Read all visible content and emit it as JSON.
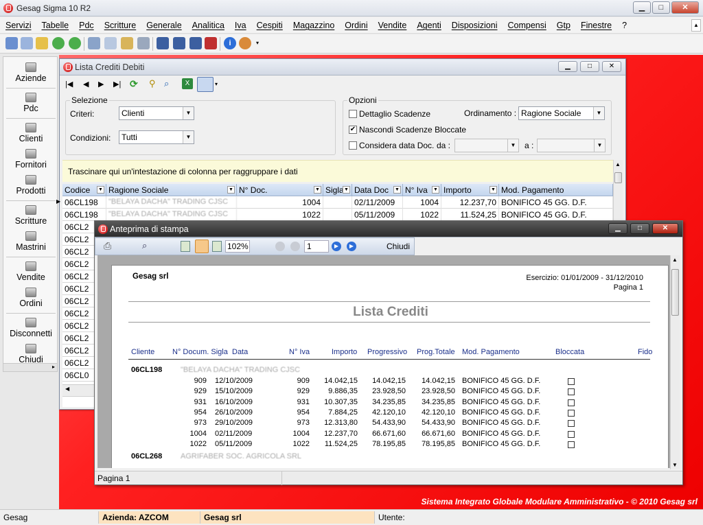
{
  "app": {
    "title": "Gesag Sigma 10 R2"
  },
  "menu": [
    "Servizi",
    "Tabelle",
    "Pdc",
    "Scritture",
    "Generale",
    "Analitica",
    "Iva",
    "Cespiti",
    "Magazzino",
    "Ordini",
    "Vendite",
    "Agenti",
    "Disposizioni",
    "Compensi",
    "Gtp",
    "Finestre",
    "?"
  ],
  "sidebar": [
    {
      "label": "Aziende",
      "icon": "gear-icon"
    },
    {
      "label": "Pdc",
      "icon": "tree-icon"
    },
    {
      "label": "Clienti",
      "icon": "client-icon"
    },
    {
      "label": "Fornitori",
      "icon": "supplier-icon"
    },
    {
      "label": "Prodotti",
      "icon": "products-icon"
    },
    {
      "label": "Scritture",
      "icon": "journal-icon"
    },
    {
      "label": "Mastrini",
      "icon": "ledger-icon"
    },
    {
      "label": "Vendite",
      "icon": "sales-icon"
    },
    {
      "label": "Ordini",
      "icon": "orders-icon"
    },
    {
      "label": "Disconnetti",
      "icon": "disconnect-icon"
    },
    {
      "label": "Chiudi",
      "icon": "exit-icon"
    }
  ],
  "desktop_footer": "Sistema Integrato Globale Modulare Amministrativo - © 2010 Gesag srl",
  "crediti_window": {
    "title": "Lista Crediti Debiti",
    "selezione": {
      "legend": "Selezione",
      "criteri_label": "Criteri:",
      "criteri_value": "Clienti",
      "condizioni_label": "Condizioni:",
      "condizioni_value": "Tutti"
    },
    "opzioni": {
      "legend": "Opzioni",
      "dettaglio": "Dettaglio Scadenze",
      "nascondi": "Nascondi Scadenze Bloccate",
      "considera": "Considera data Doc.",
      "ordinamento_label": "Ordinamento :",
      "ordinamento_value": "Ragione Sociale",
      "da_label": "da :",
      "a_label": "a :"
    },
    "group_hint": "Trascinare qui un'intestazione di colonna per raggruppare i dati",
    "columns": [
      "Codice",
      "Ragione Sociale",
      "N° Doc.",
      "Sigla",
      "Data Doc",
      "N° Iva",
      "Importo",
      "Mod. Pagamento"
    ],
    "rows": [
      {
        "codice": "06CL198",
        "ragione": "\"BELAYA DACHA\" TRADING CJSC",
        "ndoc": "1004",
        "sigla": "",
        "data": "02/11/2009",
        "niva": "1004",
        "importo": "12.237,70",
        "pag": "BONIFICO 45 GG. D.F."
      },
      {
        "codice": "06CL198",
        "ragione": "\"BELAYA DACHA\" TRADING CJSC",
        "ndoc": "1022",
        "sigla": "",
        "data": "05/11/2009",
        "niva": "1022",
        "importo": "11.524,25",
        "pag": "BONIFICO 45 GG. D.F."
      }
    ],
    "partial_rows": [
      "06CL2",
      "06CL2",
      "06CL2",
      "06CL2",
      "06CL2",
      "06CL2",
      "06CL2",
      "06CL2",
      "06CL2",
      "06CL2",
      "06CL2",
      "06CL2",
      "06CL0",
      "06CL0"
    ]
  },
  "preview_window": {
    "title": "Anteprima di stampa",
    "zoom": "102%",
    "page_input": "1",
    "close_label": "Chiudi",
    "status": "Pagina 1",
    "report": {
      "company": "Gesag srl",
      "esercizio": "Esercizio: 01/01/2009 - 31/12/2010",
      "pagina": "Pagina 1",
      "title": "Lista Crediti",
      "headers": [
        "Cliente",
        "N° Docum. Sigla",
        "Data",
        "N° Iva",
        "Importo",
        "Progressivo",
        "Prog.Totale",
        "Mod. Pagamento",
        "Bloccata",
        "Fido"
      ],
      "client1_code": "06CL198",
      "client1_name": "\"BELAYA DACHA\" TRADING CJSC",
      "lines": [
        {
          "doc": "909",
          "data": "12/10/2009",
          "iva": "909",
          "importo": "14.042,15",
          "prog": "14.042,15",
          "tot": "14.042,15",
          "pag": "BONIFICO 45 GG. D.F."
        },
        {
          "doc": "929",
          "data": "15/10/2009",
          "iva": "929",
          "importo": "9.886,35",
          "prog": "23.928,50",
          "tot": "23.928,50",
          "pag": "BONIFICO 45 GG. D.F."
        },
        {
          "doc": "931",
          "data": "16/10/2009",
          "iva": "931",
          "importo": "10.307,35",
          "prog": "34.235,85",
          "tot": "34.235,85",
          "pag": "BONIFICO 45 GG. D.F."
        },
        {
          "doc": "954",
          "data": "26/10/2009",
          "iva": "954",
          "importo": "7.884,25",
          "prog": "42.120,10",
          "tot": "42.120,10",
          "pag": "BONIFICO 45 GG. D.F."
        },
        {
          "doc": "973",
          "data": "29/10/2009",
          "iva": "973",
          "importo": "12.313,80",
          "prog": "54.433,90",
          "tot": "54.433,90",
          "pag": "BONIFICO 45 GG. D.F."
        },
        {
          "doc": "1004",
          "data": "02/11/2009",
          "iva": "1004",
          "importo": "12.237,70",
          "prog": "66.671,60",
          "tot": "66.671,60",
          "pag": "BONIFICO 45 GG. D.F."
        },
        {
          "doc": "1022",
          "data": "05/11/2009",
          "iva": "1022",
          "importo": "11.524,25",
          "prog": "78.195,85",
          "tot": "78.195,85",
          "pag": "BONIFICO 45 GG. D.F."
        }
      ],
      "client2_code": "06CL268",
      "client2_name": "AGRIFABER SOC. AGRICOLA SRL"
    }
  },
  "statusbar": {
    "user": "Gesag",
    "azienda": "Azienda: AZCOM",
    "company": "Gesag srl",
    "utente": "Utente:"
  }
}
